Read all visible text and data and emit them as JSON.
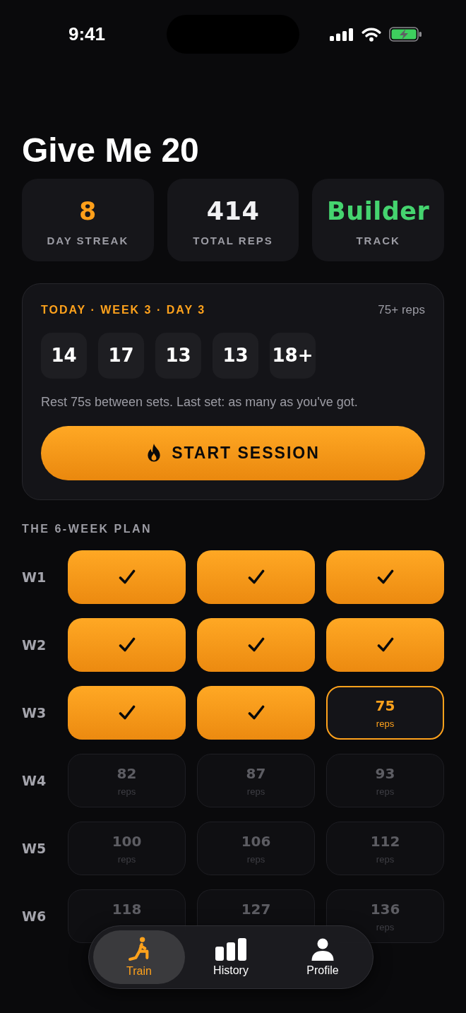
{
  "status_bar": {
    "time": "9:41"
  },
  "title": "Give Me 20",
  "stats": [
    {
      "value": "8",
      "label": "DAY STREAK",
      "color": "#ff9f1a"
    },
    {
      "value": "414",
      "label": "TOTAL REPS",
      "color": "#f2f2f4"
    },
    {
      "value": "Builder",
      "label": "TRACK",
      "color": "#45d46f"
    }
  ],
  "today": {
    "heading": "TODAY · WEEK 3 · DAY 3",
    "target": "75+ reps",
    "sets": [
      "14",
      "17",
      "13",
      "13",
      "18+"
    ],
    "note": "Rest 75s between sets. Last set: as many as you've got.",
    "button": "START SESSION"
  },
  "plan": {
    "title": "THE 6-WEEK PLAN",
    "weeks": [
      {
        "label": "W1",
        "days": [
          {
            "kind": "done"
          },
          {
            "kind": "done"
          },
          {
            "kind": "done"
          }
        ]
      },
      {
        "label": "W2",
        "days": [
          {
            "kind": "done"
          },
          {
            "kind": "done"
          },
          {
            "kind": "done"
          }
        ]
      },
      {
        "label": "W3",
        "days": [
          {
            "kind": "done"
          },
          {
            "kind": "done"
          },
          {
            "kind": "current",
            "reps": "75",
            "unit": "reps"
          }
        ]
      },
      {
        "label": "W4",
        "days": [
          {
            "kind": "upcoming",
            "reps": "82",
            "unit": "reps"
          },
          {
            "kind": "upcoming",
            "reps": "87",
            "unit": "reps"
          },
          {
            "kind": "upcoming",
            "reps": "93",
            "unit": "reps"
          }
        ]
      },
      {
        "label": "W5",
        "days": [
          {
            "kind": "upcoming",
            "reps": "100",
            "unit": "reps"
          },
          {
            "kind": "upcoming",
            "reps": "106",
            "unit": "reps"
          },
          {
            "kind": "upcoming",
            "reps": "112",
            "unit": "reps"
          }
        ]
      },
      {
        "label": "W6",
        "days": [
          {
            "kind": "upcoming",
            "reps": "118"
          },
          {
            "kind": "upcoming",
            "reps": "127"
          },
          {
            "kind": "upcoming",
            "reps": "136",
            "unit": "reps"
          }
        ]
      }
    ]
  },
  "tab_bar": {
    "tabs": [
      {
        "label": "Train",
        "selected": true
      },
      {
        "label": "History",
        "selected": false
      },
      {
        "label": "Profile",
        "selected": false
      }
    ]
  }
}
